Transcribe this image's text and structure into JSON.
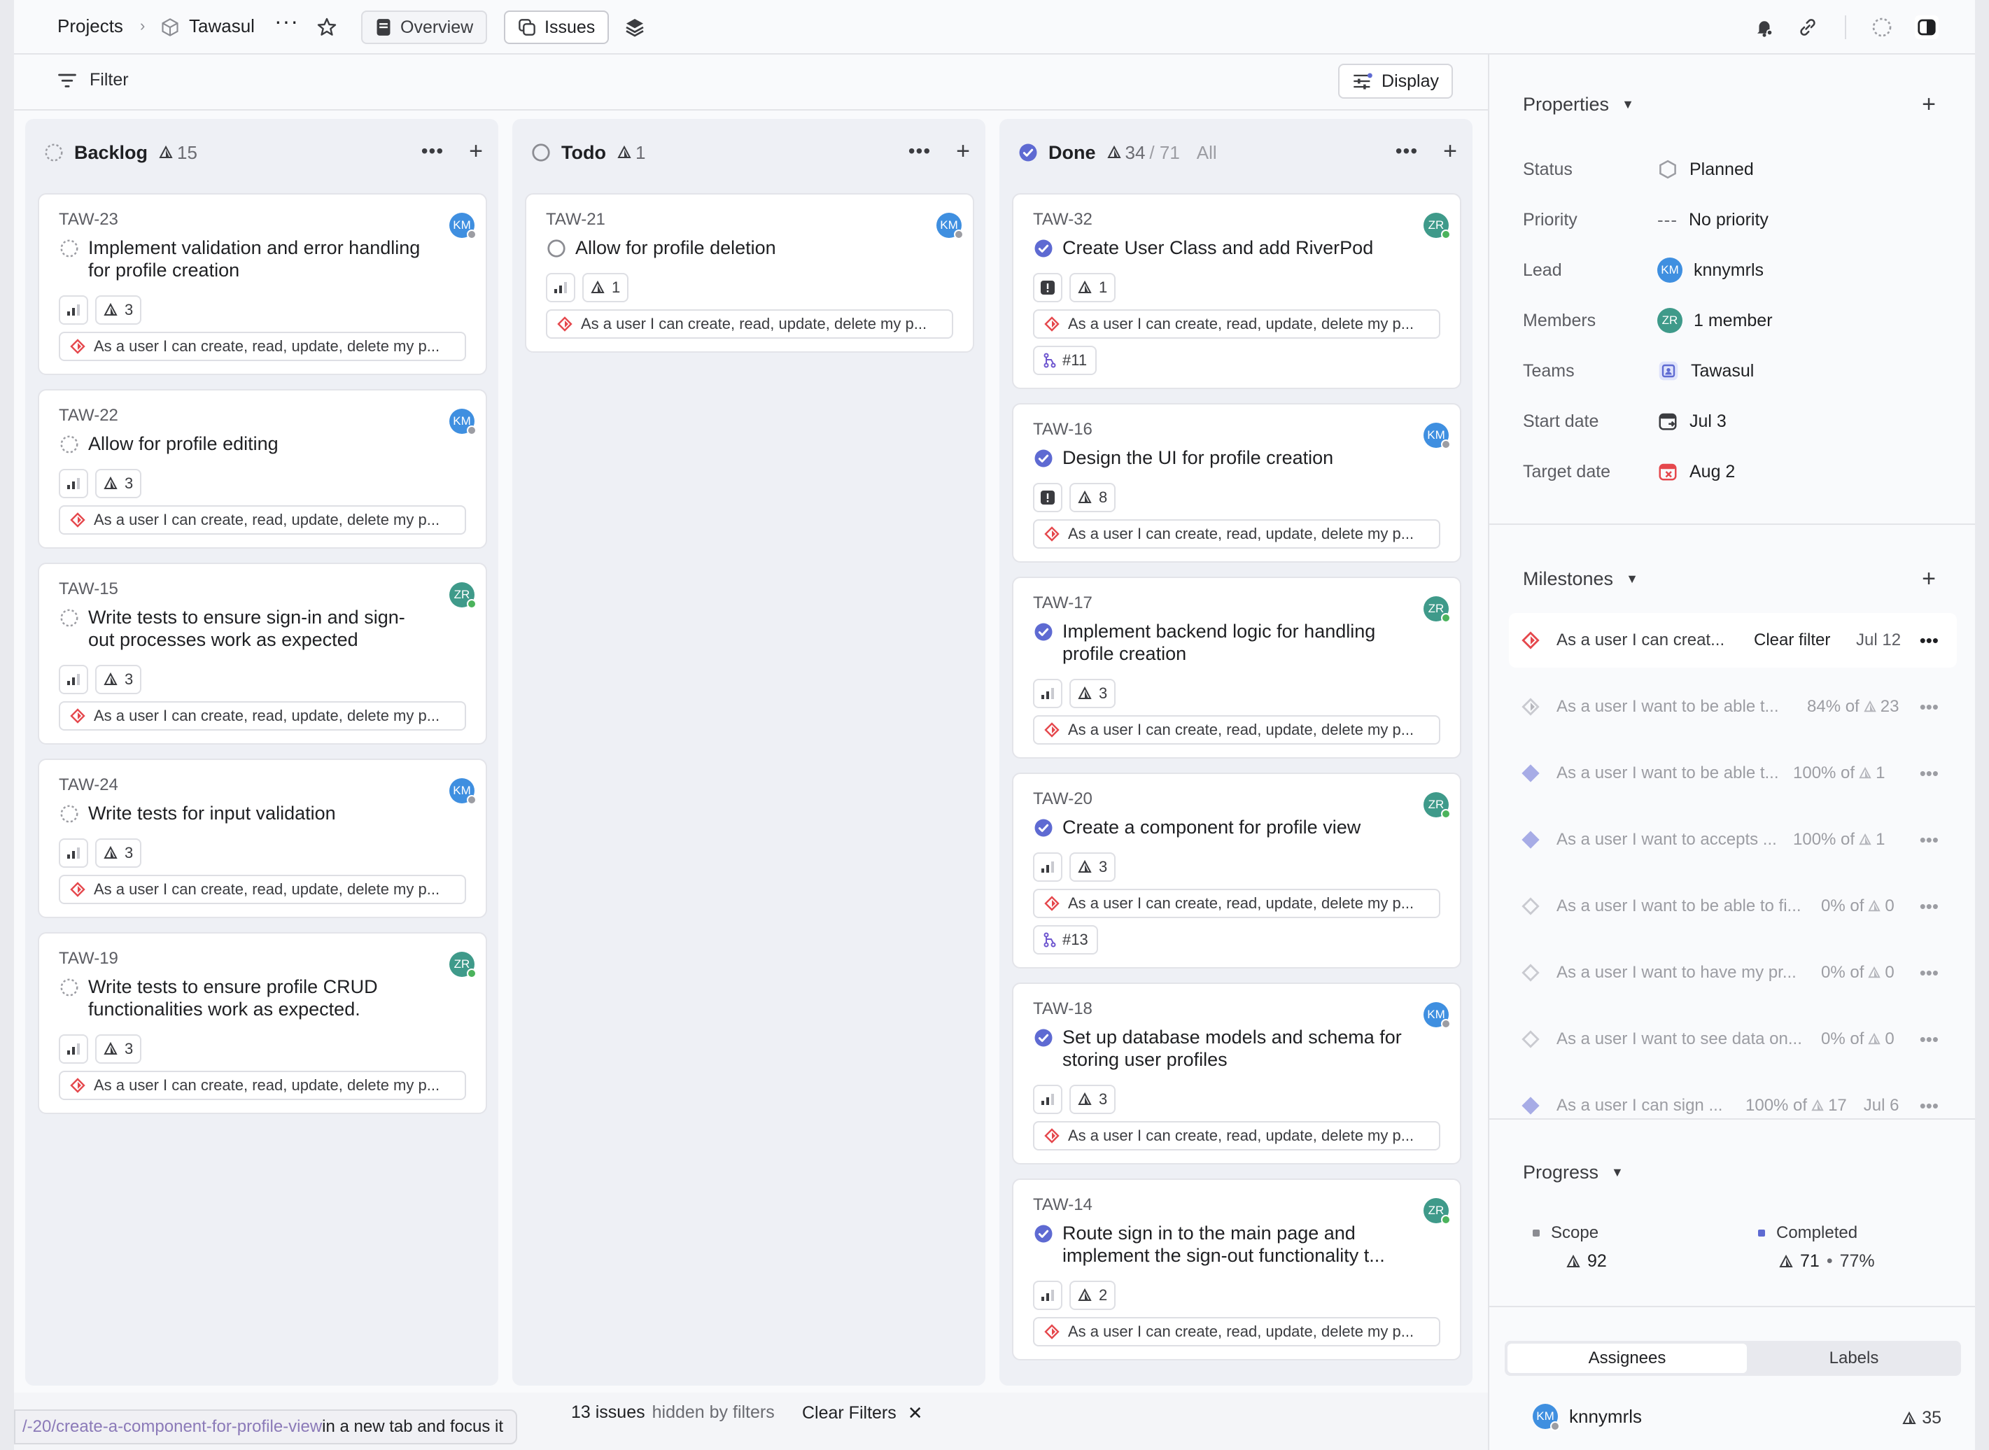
{
  "topbar": {
    "projects": "Projects",
    "project_name": "Tawasul",
    "tab_overview": "Overview",
    "tab_issues": "Issues"
  },
  "filterbar": {
    "filter_label": "Filter",
    "display_label": "Display"
  },
  "columns": [
    {
      "title": "Backlog",
      "count": "15",
      "cards": [
        {
          "id": "TAW-23",
          "title_lines": [
            "Implement validation and error handling",
            "for profile creation"
          ],
          "estimate": "3",
          "milestone": "As a user I can create, read, update, delete my p...",
          "avatar": "KM"
        },
        {
          "id": "TAW-22",
          "title_lines": [
            "Allow for profile editing"
          ],
          "estimate": "3",
          "milestone": "As a user I can create, read, update, delete my p...",
          "avatar": "KM"
        },
        {
          "id": "TAW-15",
          "title_lines": [
            "Write tests to ensure sign-in and sign-",
            "out processes work as expected"
          ],
          "estimate": "3",
          "milestone": "As a user I can create, read, update, delete my p...",
          "avatar": "ZR"
        },
        {
          "id": "TAW-24",
          "title_lines": [
            "Write tests for input validation"
          ],
          "estimate": "3",
          "milestone": "As a user I can create, read, update, delete my p...",
          "avatar": "KM"
        },
        {
          "id": "TAW-19",
          "title_lines": [
            "Write tests to ensure profile CRUD",
            "functionalities work as expected."
          ],
          "estimate": "3",
          "milestone": "As a user I can create, read, update, delete my p...",
          "avatar": "ZR"
        }
      ]
    },
    {
      "title": "Todo",
      "count": "1",
      "cards": [
        {
          "id": "TAW-21",
          "title_lines": [
            "Allow for profile deletion"
          ],
          "estimate": "1",
          "milestone": "As a user I can create, read, update, delete my p...",
          "avatar": "KM"
        }
      ]
    },
    {
      "title": "Done",
      "count": "34",
      "count_total": "/ 71",
      "count_all": "All",
      "cards": [
        {
          "id": "TAW-32",
          "title_lines": [
            "Create User Class and add RiverPod"
          ],
          "estimate": "1",
          "milestone": "As a user I can create, read, update, delete my p...",
          "pr": "#11",
          "avatar": "ZR"
        },
        {
          "id": "TAW-16",
          "title_lines": [
            "Design the UI for profile creation"
          ],
          "estimate": "8",
          "milestone": "As a user I can create, read, update, delete my p...",
          "avatar": "KM"
        },
        {
          "id": "TAW-17",
          "title_lines": [
            "Implement backend logic for handling",
            "profile creation"
          ],
          "estimate": "3",
          "milestone": "As a user I can create, read, update, delete my p...",
          "avatar": "ZR"
        },
        {
          "id": "TAW-20",
          "title_lines": [
            "Create a component for profile view"
          ],
          "estimate": "3",
          "milestone": "As a user I can create, read, update, delete my p...",
          "pr": "#13",
          "avatar": "ZR"
        },
        {
          "id": "TAW-18",
          "title_lines": [
            "Set up database models and schema for",
            "storing user profiles"
          ],
          "estimate": "3",
          "milestone": "As a user I can create, read, update, delete my p...",
          "avatar": "KM"
        },
        {
          "id": "TAW-14",
          "title_lines": [
            "Route sign in to the main page and",
            "implement the sign-out functionality t..."
          ],
          "estimate": "2",
          "milestone": "As a user I can create, read, update, delete my p...",
          "avatar": "ZR"
        }
      ]
    }
  ],
  "bottombar": {
    "hidden_count": "13 issues",
    "hidden_text": "hidden by filters",
    "clear_filters": "Clear Filters",
    "tooltip_url": "/-20/create-a-component-for-profile-view",
    "tooltip_text": " in a new tab and focus it"
  },
  "sidebar": {
    "properties_title": "Properties",
    "properties": {
      "status_label": "Status",
      "status_value": "Planned",
      "priority_label": "Priority",
      "priority_value": "No priority",
      "lead_label": "Lead",
      "lead_value": "knnymrls",
      "members_label": "Members",
      "members_value": "1 member",
      "teams_label": "Teams",
      "teams_value": "Tawasul",
      "start_label": "Start date",
      "start_value": "Jul 3",
      "target_label": "Target date",
      "target_value": "Aug 2"
    },
    "milestones_title": "Milestones",
    "milestones": [
      {
        "name": "As a user I can creat...",
        "extra": "Clear filter",
        "date": "Jul 12",
        "active": true
      },
      {
        "name": "As a user I want to be able t...",
        "pct": "84% of",
        "count": "23"
      },
      {
        "name": "As a user I want to be able t...",
        "pct": "100% of",
        "count": "1"
      },
      {
        "name": "As a user I want to accepts ...",
        "pct": "100% of",
        "count": "1"
      },
      {
        "name": "As a user I want to be able to fi...",
        "pct": "0% of",
        "count": "0"
      },
      {
        "name": "As a user I want to have my pr...",
        "pct": "0% of",
        "count": "0"
      },
      {
        "name": "As a user I want to see data on...",
        "pct": "0% of",
        "count": "0"
      },
      {
        "name": "As a user I can sign ...",
        "pct": "100% of",
        "count": "17",
        "date": "Jul 6"
      }
    ],
    "progress_title": "Progress",
    "progress": {
      "scope_label": "Scope",
      "scope_value": "92",
      "completed_label": "Completed",
      "completed_value": "71",
      "completed_pct": "77%"
    },
    "tabs": {
      "assignees": "Assignees",
      "labels": "Labels"
    },
    "assignee": {
      "name": "knnymrls",
      "count": "35"
    }
  },
  "colors": {
    "accent": "#5e6ad2",
    "avatar_km": "#3f8fe0",
    "avatar_zr": "#3f9a8a",
    "milestone_red": "#e5484d"
  }
}
